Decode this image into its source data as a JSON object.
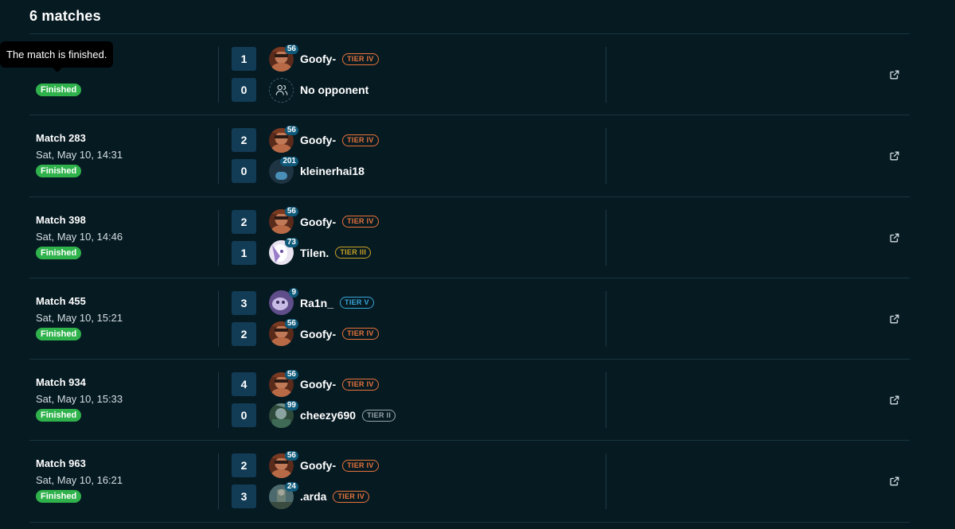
{
  "header": {
    "title": "6 matches"
  },
  "tooltip": {
    "text": "The match is finished."
  },
  "tier_colors": {
    "TIER II": "#9aa6ac",
    "TIER III": "#c9a227",
    "TIER IV": "#e8743b",
    "TIER V": "#39a7d8"
  },
  "matches": [
    {
      "name": "",
      "date": "",
      "status": "Finished",
      "top": {
        "score": "1",
        "player": "Goofy-",
        "level": "56",
        "tier": "TIER IV",
        "avatar": "goofy"
      },
      "bottom": {
        "score": "0",
        "player": "No opponent",
        "level": "",
        "tier": "",
        "avatar": "none"
      }
    },
    {
      "name": "Match 283",
      "date": "Sat, May 10, 14:31",
      "status": "Finished",
      "top": {
        "score": "2",
        "player": "Goofy-",
        "level": "56",
        "tier": "TIER IV",
        "avatar": "goofy"
      },
      "bottom": {
        "score": "0",
        "player": "kleinerhai18",
        "level": "201",
        "tier": "",
        "avatar": "default"
      }
    },
    {
      "name": "Match 398",
      "date": "Sat, May 10, 14:46",
      "status": "Finished",
      "top": {
        "score": "2",
        "player": "Goofy-",
        "level": "56",
        "tier": "TIER IV",
        "avatar": "goofy"
      },
      "bottom": {
        "score": "1",
        "player": "Tilen.",
        "level": "73",
        "tier": "TIER III",
        "avatar": "tilen"
      }
    },
    {
      "name": "Match 455",
      "date": "Sat, May 10, 15:21",
      "status": "Finished",
      "top": {
        "score": "3",
        "player": "Ra1n_",
        "level": "9",
        "tier": "TIER V",
        "avatar": "rain"
      },
      "bottom": {
        "score": "2",
        "player": "Goofy-",
        "level": "56",
        "tier": "TIER IV",
        "avatar": "goofy"
      }
    },
    {
      "name": "Match 934",
      "date": "Sat, May 10, 15:33",
      "status": "Finished",
      "top": {
        "score": "4",
        "player": "Goofy-",
        "level": "56",
        "tier": "TIER IV",
        "avatar": "goofy"
      },
      "bottom": {
        "score": "0",
        "player": "cheezy690",
        "level": "99",
        "tier": "TIER II",
        "avatar": "cheezy"
      }
    },
    {
      "name": "Match 963",
      "date": "Sat, May 10, 16:21",
      "status": "Finished",
      "top": {
        "score": "2",
        "player": "Goofy-",
        "level": "56",
        "tier": "TIER IV",
        "avatar": "goofy"
      },
      "bottom": {
        "score": "3",
        "player": ".arda",
        "level": "24",
        "tier": "TIER IV",
        "avatar": "arda"
      }
    }
  ]
}
